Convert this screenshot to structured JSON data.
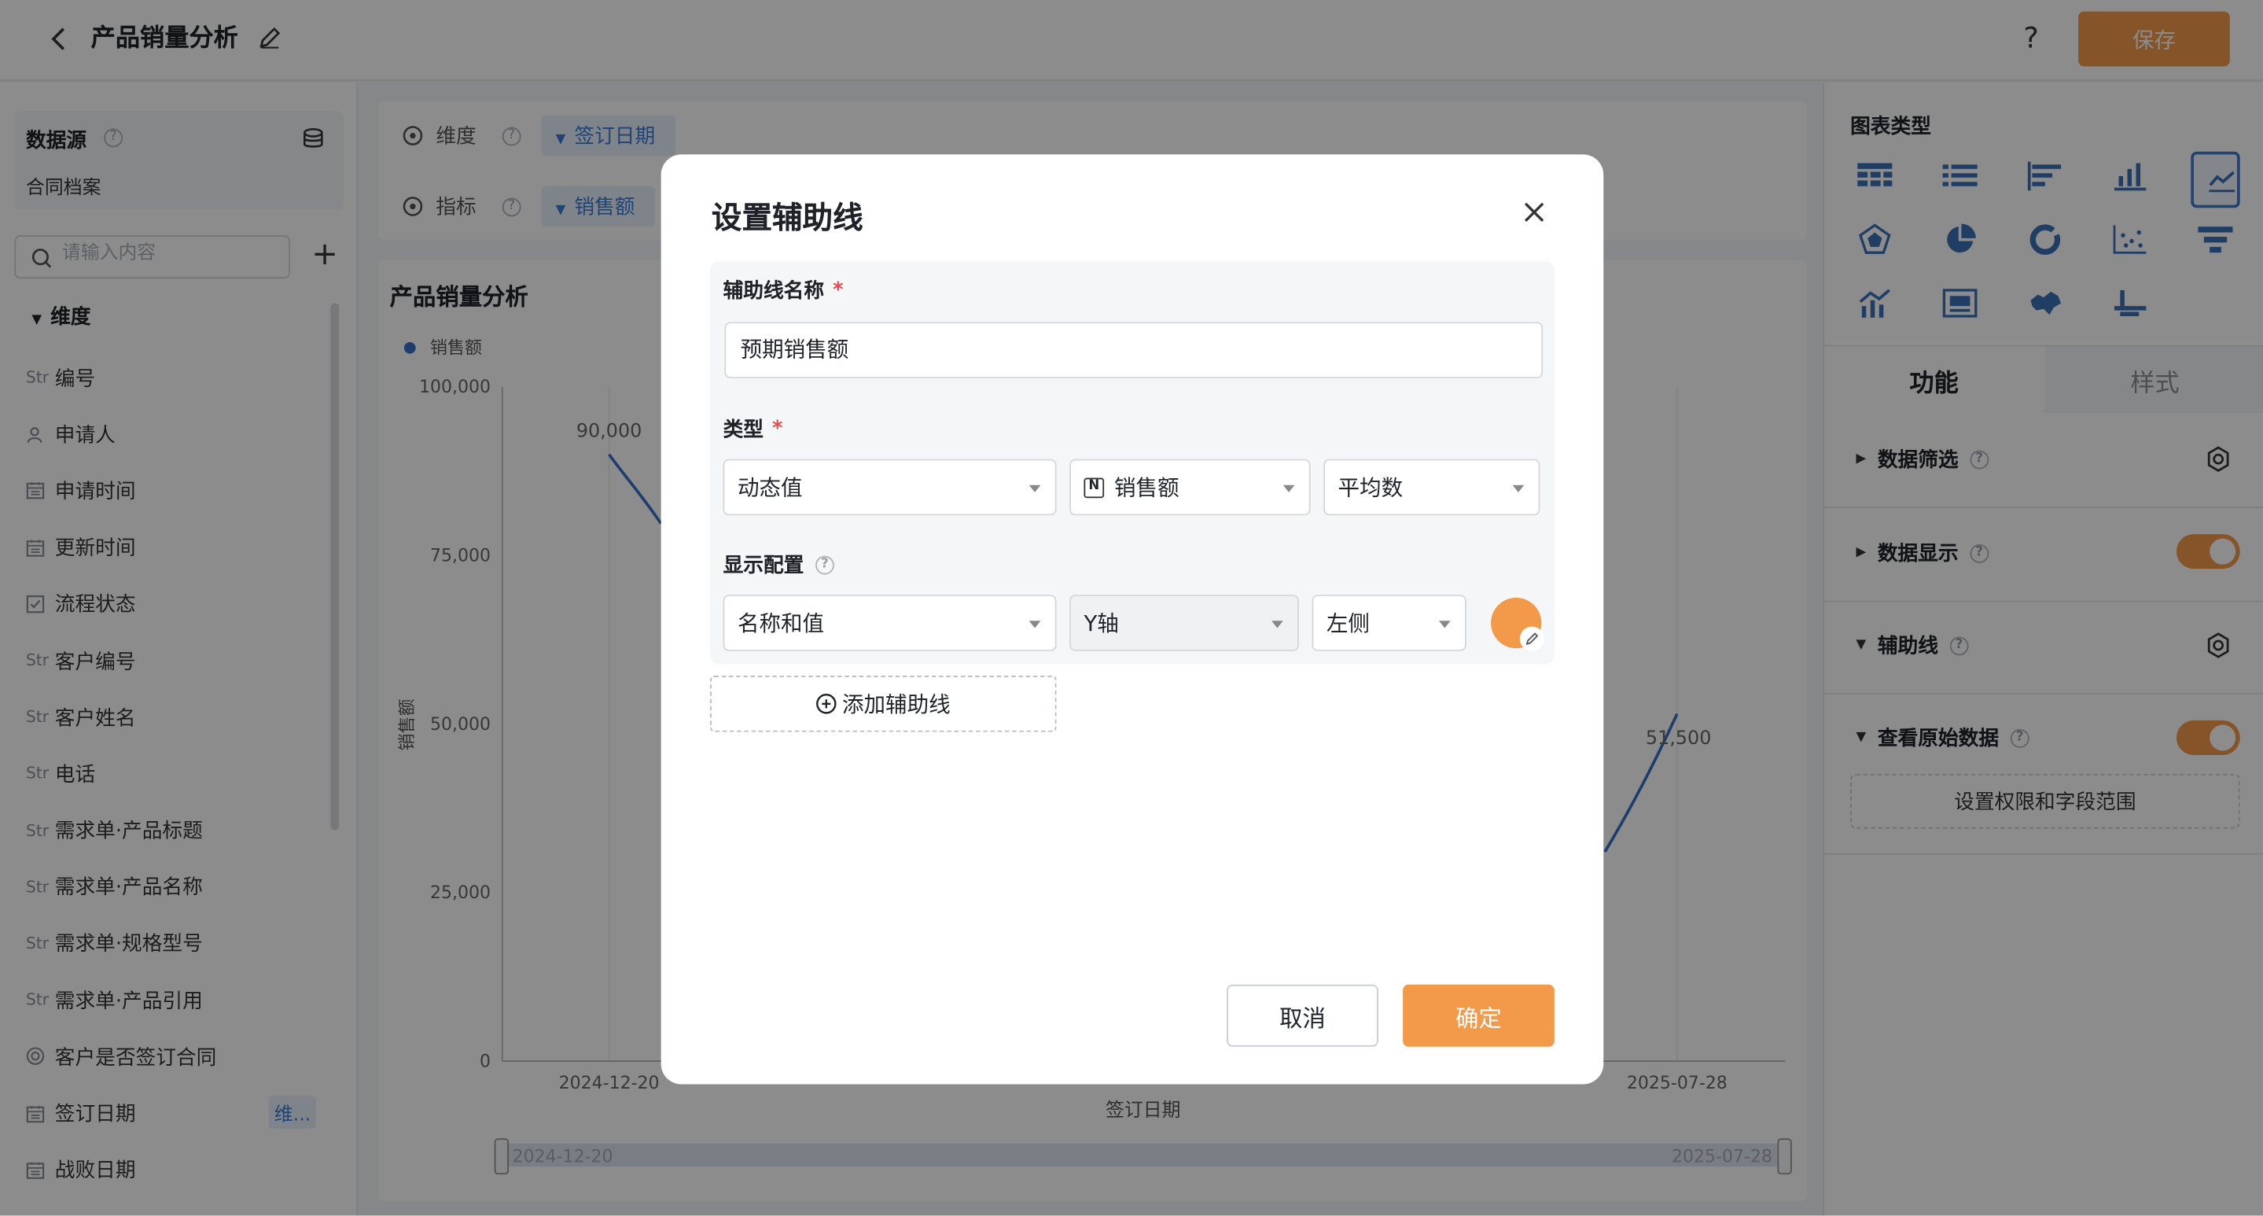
{
  "header": {
    "title": "产品销量分析",
    "help": "?",
    "save_label": "保存"
  },
  "datasource": {
    "title": "数据源",
    "name": "合同档案",
    "search_placeholder": "请输入内容",
    "dimension_header": "维度"
  },
  "fields": [
    {
      "icon": "Str",
      "label": "编号"
    },
    {
      "icon": "user-icon",
      "label": "申请人"
    },
    {
      "icon": "calendar-icon",
      "label": "申请时间"
    },
    {
      "icon": "calendar-icon",
      "label": "更新时间"
    },
    {
      "icon": "checkbox-icon",
      "label": "流程状态"
    },
    {
      "icon": "Str",
      "label": "客户编号"
    },
    {
      "icon": "Str",
      "label": "客户姓名"
    },
    {
      "icon": "Str",
      "label": "电话"
    },
    {
      "icon": "Str",
      "label": "需求单·产品标题"
    },
    {
      "icon": "Str",
      "label": "需求单·产品名称"
    },
    {
      "icon": "Str",
      "label": "需求单·规格型号"
    },
    {
      "icon": "Str",
      "label": "需求单·产品引用"
    },
    {
      "icon": "radio-icon",
      "label": "客户是否签订合同"
    },
    {
      "icon": "calendar-icon",
      "label": "签订日期",
      "tag": "维..."
    },
    {
      "icon": "calendar-icon",
      "label": "战败日期"
    }
  ],
  "config": {
    "dimension_label": "维度",
    "dimension_value": "签订日期",
    "metric_label": "指标",
    "metric_value": "销售额"
  },
  "chart": {
    "title": "产品销量分析",
    "legend": "销售额",
    "ylabel": "销售额",
    "xlabel": "签订日期"
  },
  "chart_data": {
    "type": "line",
    "title": "产品销量分析",
    "ylabel": "销售额",
    "xlabel": "签订日期",
    "ylim": [
      0,
      100000
    ],
    "yticks": [
      "100,000",
      "75,000",
      "50,000",
      "25,000",
      "0"
    ],
    "x_visible_ticks": [
      "2024-12-20",
      "2025-07-28"
    ],
    "series": [
      {
        "name": "销售额",
        "points": [
          {
            "x": "2024-12-20",
            "y": 90000,
            "label": "90,000"
          },
          {
            "x": "2025-07-28",
            "y": 51500,
            "label": "51,500"
          }
        ]
      }
    ],
    "range_slider": {
      "start": "2024-12-20",
      "end": "2025-07-28"
    }
  },
  "right_panel": {
    "chart_type_title": "图表类型",
    "tab_function": "功能",
    "tab_style": "样式",
    "sections": {
      "filter": "数据筛选",
      "display": "数据显示",
      "aux_line": "辅助线",
      "raw_data": "查看原始数据"
    },
    "perm_button": "设置权限和字段范围"
  },
  "modal": {
    "title": "设置辅助线",
    "name_label": "辅助线名称",
    "name_value": "预期销售额",
    "type_label": "类型",
    "type_value": "动态值",
    "field_value": "销售额",
    "agg_value": "平均数",
    "display_label": "显示配置",
    "display_value": "名称和值",
    "axis_value": "Y轴",
    "side_value": "左侧",
    "color": "#f2994a",
    "add_label": "添加辅助线",
    "cancel_label": "取消",
    "ok_label": "确定"
  },
  "colors": {
    "accent": "#f2994a",
    "link": "#3b7bd6",
    "line": "#3370c8"
  }
}
